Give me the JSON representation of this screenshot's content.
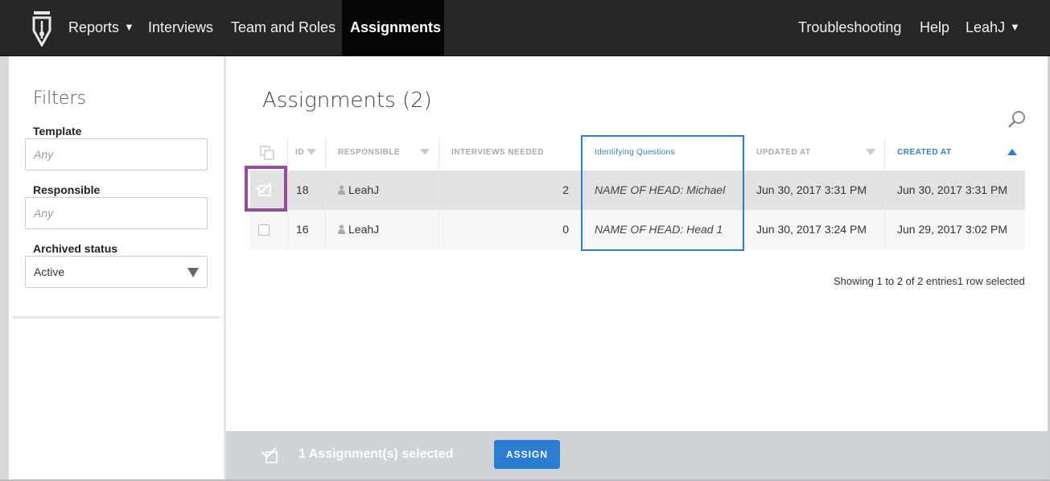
{
  "nav": {
    "items": [
      {
        "label": "Reports",
        "caret": "▼"
      },
      {
        "label": "Interviews"
      },
      {
        "label": "Team and Roles"
      },
      {
        "label": "Assignments"
      }
    ],
    "right": {
      "troubleshooting": "Troubleshooting",
      "help": "Help",
      "user": "LeahJ",
      "user_caret": "▼"
    }
  },
  "filters": {
    "title": "Filters",
    "template": {
      "label": "Template",
      "placeholder": "Any"
    },
    "responsible": {
      "label": "Responsible",
      "placeholder": "Any"
    },
    "archived": {
      "label": "Archived status",
      "value": "Active"
    }
  },
  "main": {
    "title": "Assignments (2)",
    "columns": {
      "id": "ID",
      "responsible": "RESPONSIBLE",
      "interviews_needed": "INTERVIEWS NEEDED",
      "identifying_questions": "Identifying Questions",
      "updated_at": "UPDATED AT",
      "created_at": "CREATED AT"
    },
    "rows": [
      {
        "id": "18",
        "responsible": "LeahJ",
        "needed": "2",
        "idq": "NAME OF HEAD: Michael",
        "updated": "Jun 30, 2017 3:31 PM",
        "created": "Jun 30, 2017 3:31 PM",
        "selected": true
      },
      {
        "id": "16",
        "responsible": "LeahJ",
        "needed": "0",
        "idq": "NAME OF HEAD: Head 1",
        "updated": "Jun 30, 2017 3:24 PM",
        "created": "Jun 29, 2017 3:02 PM",
        "selected": false
      }
    ],
    "info": "Showing 1 to 2 of 2 entries1 row selected"
  },
  "bottom": {
    "selected_text": "1 Assignment(s) selected",
    "assign_label": "ASSIGN"
  },
  "colors": {
    "navbar": "#262626",
    "accent": "#2b7cd3",
    "selection_highlight": "#9a4a9e",
    "bottom_bar": "#cfd3d8"
  },
  "icons": [
    "app-logo-icon",
    "search-icon",
    "select-all-icon",
    "row-selected-icon",
    "person-icon",
    "assign-icon"
  ]
}
